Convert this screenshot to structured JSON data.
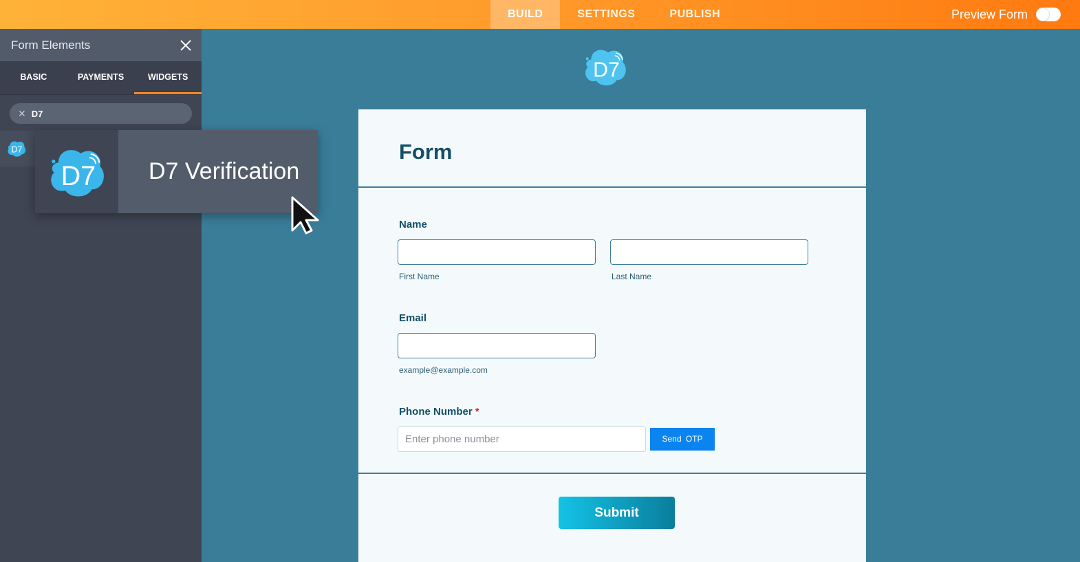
{
  "topbar": {
    "tabs": [
      {
        "label": "BUILD",
        "active": true
      },
      {
        "label": "SETTINGS",
        "active": false
      },
      {
        "label": "PUBLISH",
        "active": false
      }
    ],
    "preview_label": "Preview Form",
    "preview_enabled": false
  },
  "sidebar": {
    "title": "Form Elements",
    "tabs": [
      {
        "label": "BASIC",
        "active": false
      },
      {
        "label": "PAYMENTS",
        "active": false
      },
      {
        "label": "WIDGETS",
        "active": true
      }
    ],
    "search_value": "D7",
    "drag_item_label": "D7 Verification"
  },
  "form": {
    "title": "Form",
    "name_label": "Name",
    "first_name_sublabel": "First Name",
    "last_name_sublabel": "Last Name",
    "email_label": "Email",
    "email_sublabel": "example@example.com",
    "phone_label": "Phone Number",
    "required_mark": "*",
    "phone_placeholder": "Enter phone number",
    "send_otp_label": "Send  OTP",
    "submit_label": "Submit"
  },
  "colors": {
    "accent_orange": "#ff8a26",
    "canvas_bg": "#3a7d98",
    "sidebar_bg": "#3f4553",
    "otp_button": "#0b84f0",
    "logo_blue": "#3bb6ea"
  },
  "icons": {
    "close": "close-icon",
    "clear": "clear-search-icon",
    "logo": "d7-logo-icon",
    "cursor": "mouse-cursor-icon"
  }
}
